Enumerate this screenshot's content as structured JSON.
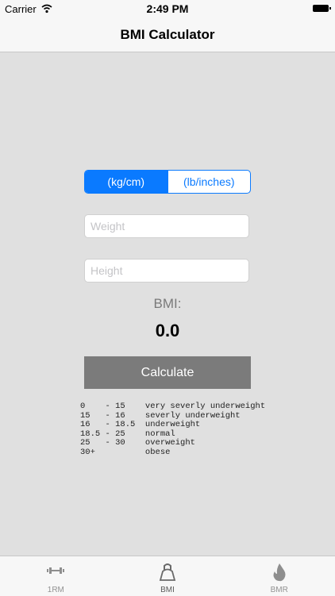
{
  "status_bar": {
    "carrier": "Carrier",
    "time": "2:49 PM"
  },
  "nav": {
    "title": "BMI Calculator"
  },
  "units": {
    "options": [
      "(kg/cm)",
      "(lb/inches)"
    ],
    "selected": "(kg/cm)"
  },
  "inputs": {
    "weight_placeholder": "Weight",
    "height_placeholder": "Height"
  },
  "result": {
    "label": "BMI:",
    "value": "0.0"
  },
  "calculate_label": "Calculate",
  "ranges": [
    {
      "from": "0",
      "to": "15",
      "label": "very severly underweight"
    },
    {
      "from": "15",
      "to": "16",
      "label": "severly underweight"
    },
    {
      "from": "16",
      "to": "18.5",
      "label": "underweight"
    },
    {
      "from": "18.5",
      "to": "25",
      "label": "normal"
    },
    {
      "from": "25",
      "to": "30",
      "label": "overweight"
    },
    {
      "from": "30+",
      "to": "",
      "label": "obese"
    }
  ],
  "tabs": [
    {
      "label": "1RM",
      "icon": "dumbbell-icon"
    },
    {
      "label": "BMI",
      "icon": "kettlebell-icon",
      "active": true
    },
    {
      "label": "BMR",
      "icon": "flame-icon"
    }
  ],
  "colors": {
    "accent": "#0a7aff",
    "button": "#7b7b7b",
    "background": "#e0e0e0"
  }
}
